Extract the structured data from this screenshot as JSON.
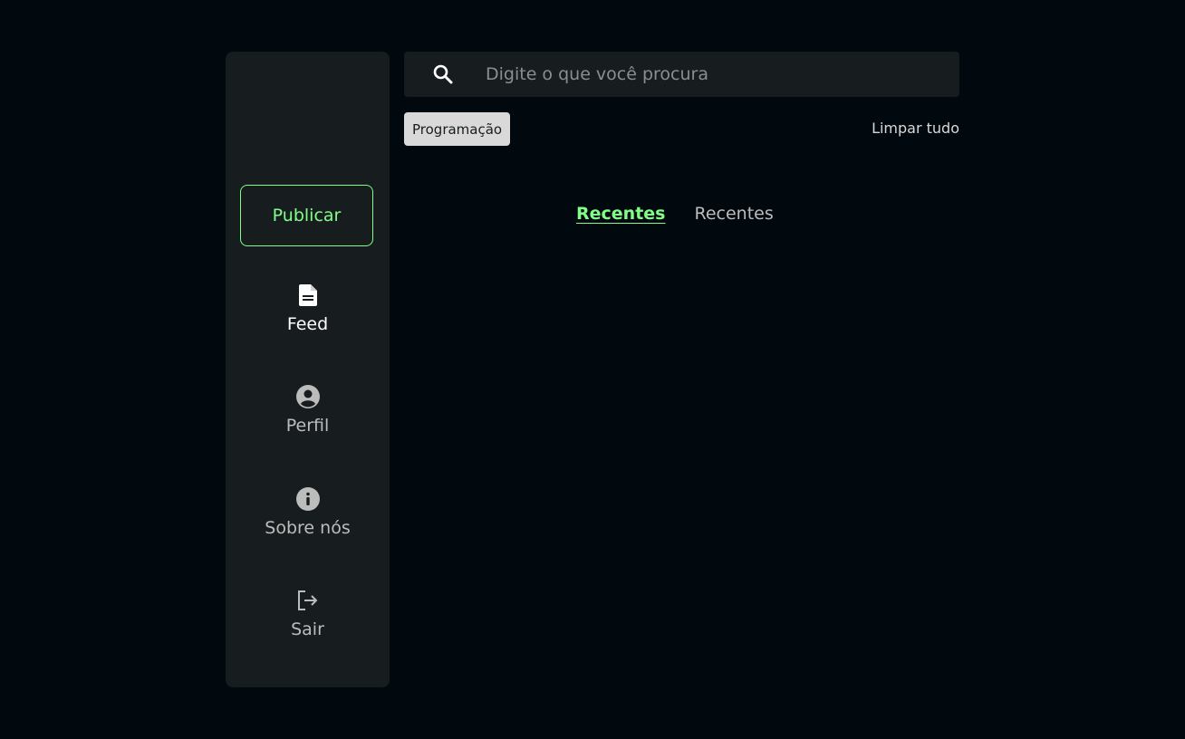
{
  "sidebar": {
    "publish_label": "Publicar",
    "items": [
      {
        "label": "Feed",
        "icon": "document-icon"
      },
      {
        "label": "Perfil",
        "icon": "user-circle-icon"
      },
      {
        "label": "Sobre nós",
        "icon": "info-icon"
      },
      {
        "label": "Sair",
        "icon": "logout-icon"
      }
    ]
  },
  "search": {
    "placeholder": "Digite o que você procura",
    "value": ""
  },
  "filters": {
    "tags": [
      "Programação"
    ],
    "clear_label": "Limpar tudo"
  },
  "tabs": [
    {
      "label": "Recentes",
      "active": true
    },
    {
      "label": "Recentes",
      "active": false
    }
  ],
  "colors": {
    "accent": "#81fe88",
    "background": "#01080e",
    "panel": "#171d1f",
    "tag_background": "#d9d9d9"
  }
}
